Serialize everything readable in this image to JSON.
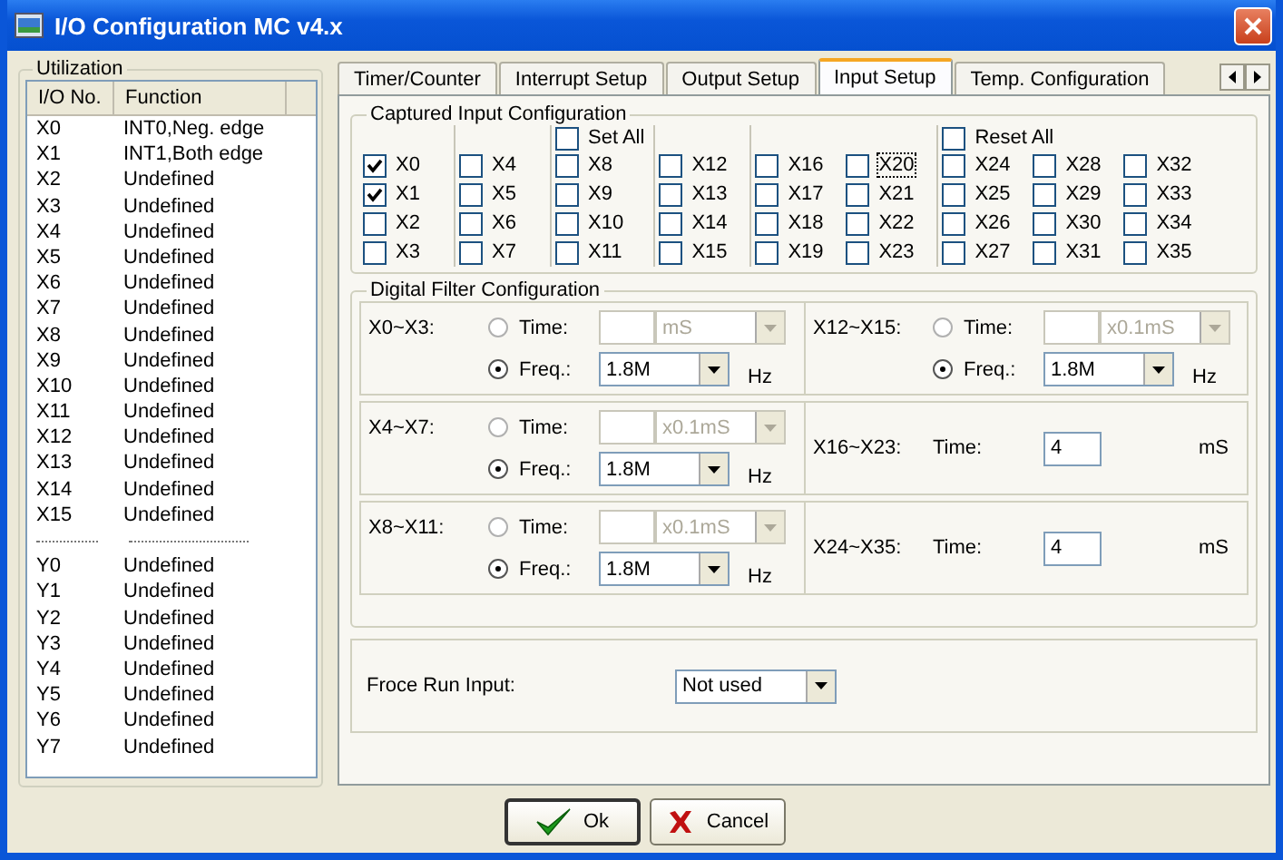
{
  "window": {
    "title": "I/O Configuration MC v4.x"
  },
  "utilization": {
    "title": "Utilization",
    "columns": [
      "I/O No.",
      "Function"
    ],
    "rows": [
      {
        "kind": "entry",
        "io": "X0",
        "function": "INT0,Neg. edge"
      },
      {
        "kind": "entry",
        "io": "X1",
        "function": "INT1,Both edge"
      },
      {
        "kind": "entry",
        "io": "X2",
        "function": "Undefined"
      },
      {
        "kind": "entry",
        "io": "X3",
        "function": "Undefined"
      },
      {
        "kind": "entry",
        "io": "X4",
        "function": "Undefined"
      },
      {
        "kind": "entry",
        "io": "X5",
        "function": "Undefined"
      },
      {
        "kind": "entry",
        "io": "X6",
        "function": "Undefined"
      },
      {
        "kind": "entry",
        "io": "X7",
        "function": "Undefined"
      },
      {
        "kind": "entry",
        "io": "X8",
        "function": "Undefined"
      },
      {
        "kind": "entry",
        "io": "X9",
        "function": "Undefined"
      },
      {
        "kind": "entry",
        "io": "X10",
        "function": "Undefined"
      },
      {
        "kind": "entry",
        "io": "X11",
        "function": "Undefined"
      },
      {
        "kind": "entry",
        "io": "X12",
        "function": "Undefined"
      },
      {
        "kind": "entry",
        "io": "X13",
        "function": "Undefined"
      },
      {
        "kind": "entry",
        "io": "X14",
        "function": "Undefined"
      },
      {
        "kind": "entry",
        "io": "X15",
        "function": "Undefined"
      },
      {
        "kind": "separator"
      },
      {
        "kind": "entry",
        "io": "Y0",
        "function": "Undefined"
      },
      {
        "kind": "entry",
        "io": "Y1",
        "function": "Undefined"
      },
      {
        "kind": "entry",
        "io": "Y2",
        "function": "Undefined"
      },
      {
        "kind": "entry",
        "io": "Y3",
        "function": "Undefined"
      },
      {
        "kind": "entry",
        "io": "Y4",
        "function": "Undefined"
      },
      {
        "kind": "entry",
        "io": "Y5",
        "function": "Undefined"
      },
      {
        "kind": "entry",
        "io": "Y6",
        "function": "Undefined"
      },
      {
        "kind": "entry",
        "io": "Y7",
        "function": "Undefined"
      }
    ]
  },
  "tabs": [
    {
      "label": "Timer/Counter",
      "selected": false
    },
    {
      "label": "Interrupt Setup",
      "selected": false
    },
    {
      "label": "Output Setup",
      "selected": false
    },
    {
      "label": "Input Setup",
      "selected": true
    },
    {
      "label": "Temp. Configuration",
      "selected": false
    }
  ],
  "captured": {
    "title": "Captured Input Configuration",
    "groups": [
      {
        "columns": [
          [
            {
              "label": "X0",
              "checked": true
            },
            {
              "label": "X1",
              "checked": true
            },
            {
              "label": "X2",
              "checked": false
            },
            {
              "label": "X3",
              "checked": false
            }
          ]
        ]
      },
      {
        "columns": [
          [
            {
              "label": "X4",
              "checked": false
            },
            {
              "label": "X5",
              "checked": false
            },
            {
              "label": "X6",
              "checked": false
            },
            {
              "label": "X7",
              "checked": false
            }
          ]
        ]
      },
      {
        "header": {
          "label": "Set All",
          "checked": false
        },
        "columns": [
          [
            {
              "label": "X8",
              "checked": false
            },
            {
              "label": "X9",
              "checked": false
            },
            {
              "label": "X10",
              "checked": false
            },
            {
              "label": "X11",
              "checked": false
            }
          ]
        ]
      },
      {
        "columns": [
          [
            {
              "label": "X12",
              "checked": false
            },
            {
              "label": "X13",
              "checked": false
            },
            {
              "label": "X14",
              "checked": false
            },
            {
              "label": "X15",
              "checked": false
            }
          ]
        ]
      },
      {
        "columns": [
          [
            {
              "label": "X16",
              "checked": false
            },
            {
              "label": "X17",
              "checked": false
            },
            {
              "label": "X18",
              "checked": false
            },
            {
              "label": "X19",
              "checked": false
            }
          ],
          [
            {
              "label": "X20",
              "checked": false,
              "focused": true
            },
            {
              "label": "X21",
              "checked": false
            },
            {
              "label": "X22",
              "checked": false
            },
            {
              "label": "X23",
              "checked": false
            }
          ]
        ]
      },
      {
        "header": {
          "label": "Reset All",
          "checked": false
        },
        "columns": [
          [
            {
              "label": "X24",
              "checked": false
            },
            {
              "label": "X25",
              "checked": false
            },
            {
              "label": "X26",
              "checked": false
            },
            {
              "label": "X27",
              "checked": false
            }
          ],
          [
            {
              "label": "X28",
              "checked": false
            },
            {
              "label": "X29",
              "checked": false
            },
            {
              "label": "X30",
              "checked": false
            },
            {
              "label": "X31",
              "checked": false
            }
          ],
          [
            {
              "label": "X32",
              "checked": false
            },
            {
              "label": "X33",
              "checked": false
            },
            {
              "label": "X34",
              "checked": false
            },
            {
              "label": "X35",
              "checked": false
            }
          ]
        ]
      }
    ]
  },
  "filter": {
    "title": "Digital Filter Configuration",
    "rows": [
      [
        {
          "kind": "choice",
          "label": "X0~X3:",
          "time_label": "Time:",
          "time_selected": false,
          "time_unit": "mS",
          "freq_label": "Freq.:",
          "freq_selected": true,
          "freq_value": "1.8M",
          "freq_unit": "Hz"
        },
        {
          "kind": "choice",
          "label": "X12~X15:",
          "time_label": "Time:",
          "time_selected": false,
          "time_unit": "x0.1mS",
          "freq_label": "Freq.:",
          "freq_selected": true,
          "freq_value": "1.8M",
          "freq_unit": "Hz"
        }
      ],
      [
        {
          "kind": "choice",
          "label": "X4~X7:",
          "time_label": "Time:",
          "time_selected": false,
          "time_unit": "x0.1mS",
          "freq_label": "Freq.:",
          "freq_selected": true,
          "freq_value": "1.8M",
          "freq_unit": "Hz"
        },
        {
          "kind": "time",
          "label": "X16~X23:",
          "time_label": "Time:",
          "time_value": "4",
          "time_unit": "mS"
        }
      ],
      [
        {
          "kind": "choice",
          "label": "X8~X11:",
          "time_label": "Time:",
          "time_selected": false,
          "time_unit": "x0.1mS",
          "freq_label": "Freq.:",
          "freq_selected": true,
          "freq_value": "1.8M",
          "freq_unit": "Hz"
        },
        {
          "kind": "time",
          "label": "X24~X35:",
          "time_label": "Time:",
          "time_value": "4",
          "time_unit": "mS"
        }
      ]
    ]
  },
  "force_run": {
    "label": "Froce Run Input:",
    "value": "Not used"
  },
  "buttons": [
    {
      "kind": "ok",
      "label": "Ok"
    },
    {
      "kind": "cancel",
      "label": "Cancel"
    }
  ]
}
